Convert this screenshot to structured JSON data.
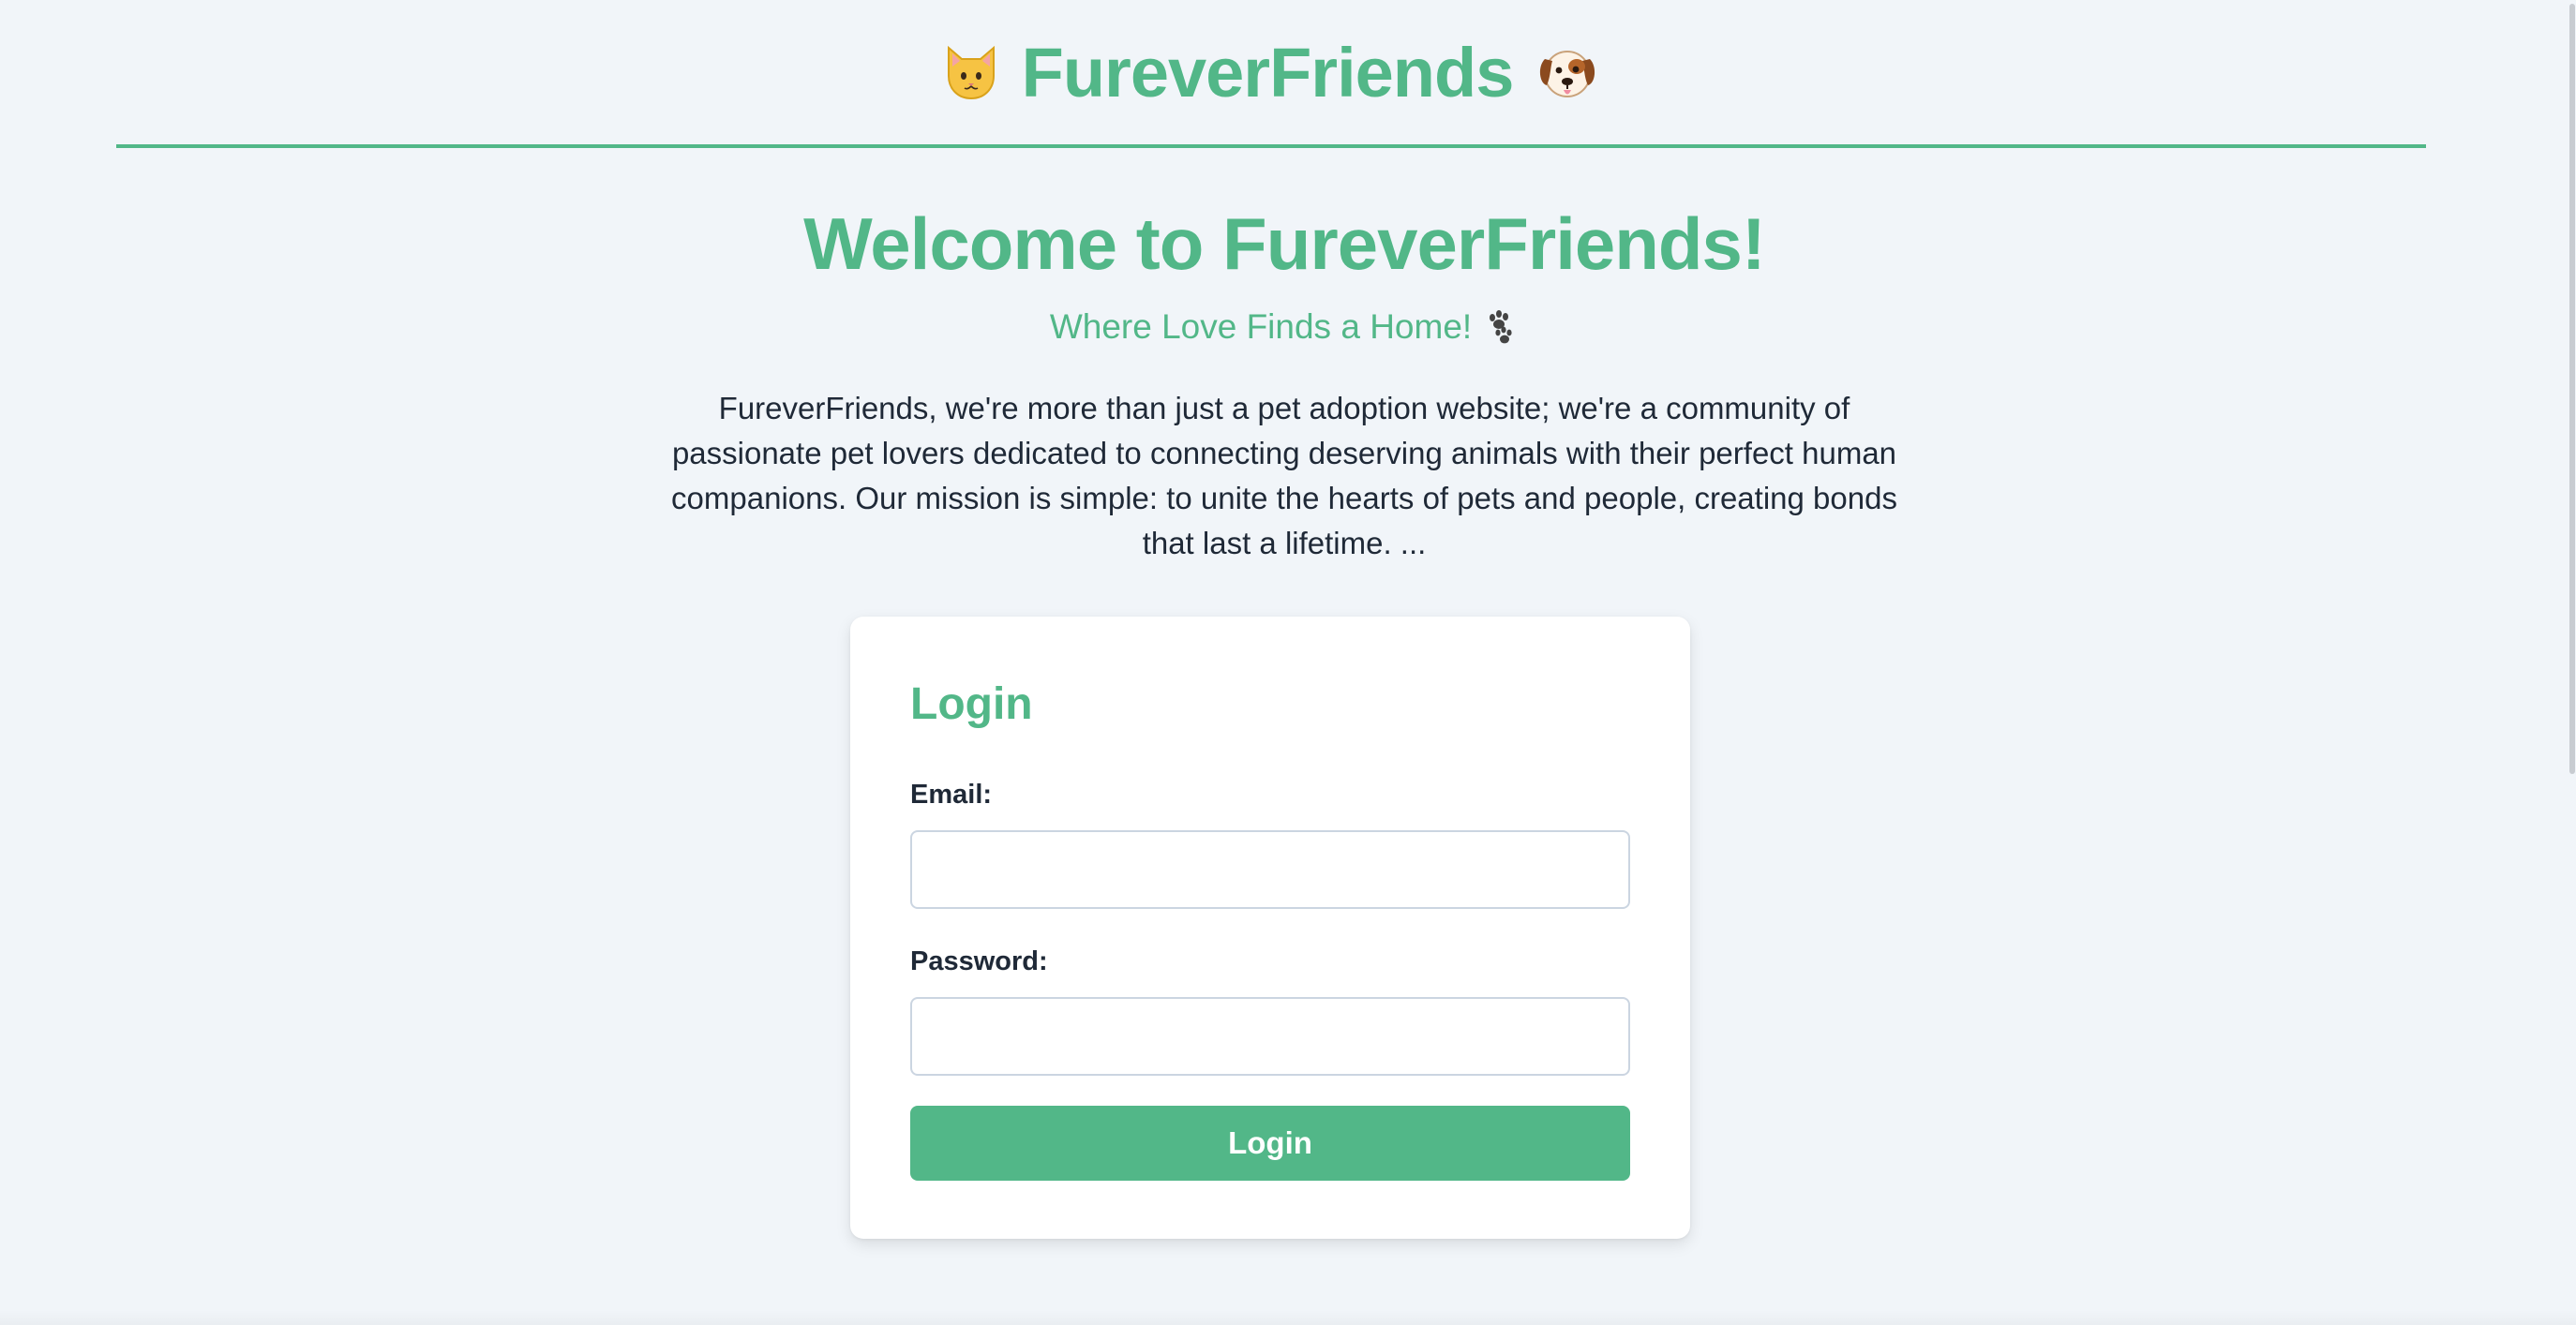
{
  "header": {
    "title": "FureverFriends",
    "left_icon": "cat-face-icon",
    "right_icon": "dog-face-icon"
  },
  "hero": {
    "title": "Welcome to FureverFriends!",
    "subtitle": "Where Love Finds a Home!",
    "subtitle_icon": "paw-prints-icon",
    "description": "FureverFriends, we're more than just a pet adoption website; we're a community of passionate pet lovers dedicated to connecting deserving animals with their perfect human companions. Our mission is simple: to unite the hearts of pets and people, creating bonds that last a lifetime. ..."
  },
  "login": {
    "title": "Login",
    "email_label": "Email:",
    "email_value": "",
    "password_label": "Password:",
    "password_value": "",
    "button_label": "Login"
  },
  "colors": {
    "accent": "#52b788",
    "background": "#f1f5f9",
    "text": "#1f2937",
    "card": "#ffffff"
  }
}
